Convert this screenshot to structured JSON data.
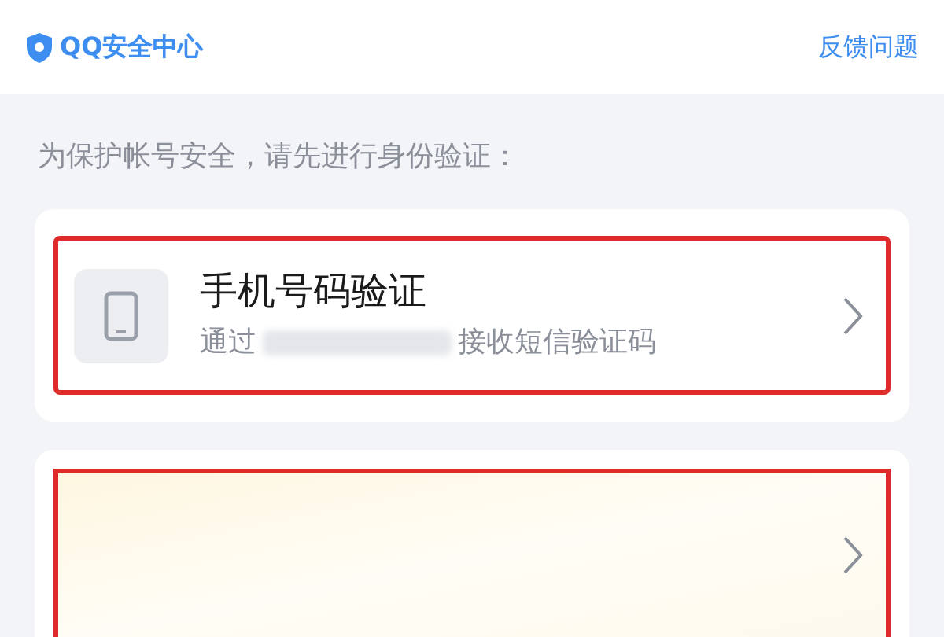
{
  "header": {
    "title": "QQ安全中心",
    "link": "反馈问题"
  },
  "instruction": "为保护帐号安全，请先进行身份验证：",
  "methods": [
    {
      "kind": "phone",
      "title": "手机号码验证",
      "subtitle_before": "通过",
      "subtitle_after": "接收短信验证码",
      "highlighted": true
    },
    {
      "kind": "obscured",
      "highlighted": true
    }
  ]
}
